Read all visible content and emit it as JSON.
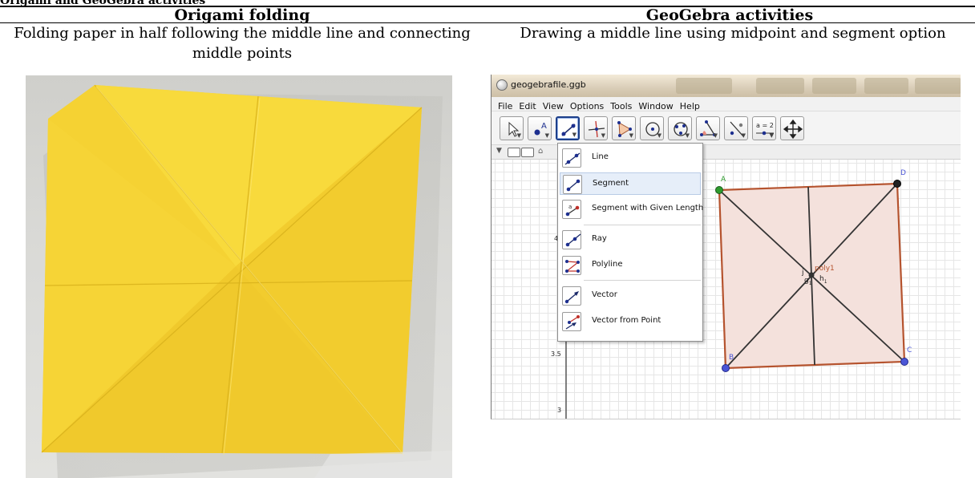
{
  "document": {
    "table_caption": "Origami and GeoGebra activities",
    "columns": [
      {
        "heading": "Origami folding",
        "description": "Folding paper in half following the middle line and connecting middle points"
      },
      {
        "heading": "GeoGebra activities",
        "description": "Drawing a middle line using midpoint and segment option"
      }
    ]
  },
  "photo": {
    "subject": "folded-yellow-origami-square",
    "paper_color": "#f5d233",
    "background_color": "#d6d6d3"
  },
  "geogebra": {
    "window_title": "geogebrafile.ggb",
    "menu": [
      "File",
      "Edit",
      "View",
      "Options",
      "Tools",
      "Window",
      "Help"
    ],
    "toolbar": {
      "tools": [
        "move-tool-icon",
        "point-tool-icon",
        "line-tool-icon",
        "perpendicular-tool-icon",
        "polygon-tool-icon",
        "circle-tool-icon",
        "circle-three-points-tool-icon",
        "angle-tool-icon",
        "reflect-tool-icon",
        "slider-tool-icon",
        "move-view-tool-icon"
      ],
      "active_tool": "line-tool-icon",
      "slider_label": "a = 2"
    },
    "dropdown": {
      "items": [
        "Line",
        "Segment",
        "Segment with Given Length",
        "Ray",
        "Polyline",
        "Vector",
        "Vector from Point"
      ],
      "highlighted": "Segment",
      "given_length_icon_label": "a"
    },
    "canvas": {
      "axis_labels": [
        "4.",
        "3.5",
        "3"
      ],
      "points": [
        "A",
        "B",
        "C",
        "D"
      ],
      "center_labels": {
        "poly": "poly1",
        "j": "j",
        "g": "g",
        "h": "h",
        "g_sub": "1",
        "h_sub": "1"
      },
      "colors": {
        "polygon_edge": "#b5532e",
        "polygon_fill": "#f4e1dc",
        "segment": "#333333",
        "point_blue": "#4a55d6",
        "point_green": "#2e9b2e",
        "point_black": "#222222"
      }
    }
  }
}
